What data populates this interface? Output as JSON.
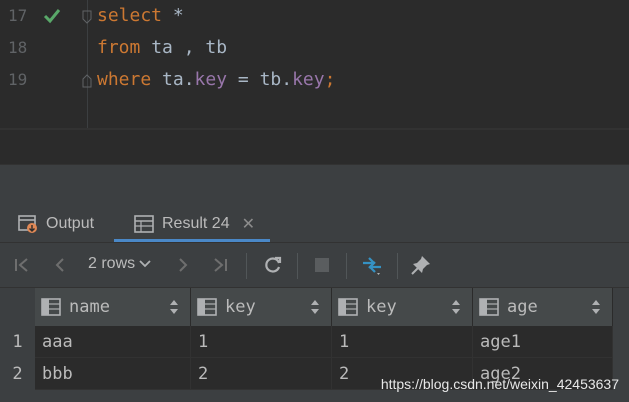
{
  "editor": {
    "lines": [
      {
        "num": "17",
        "kw1": "select",
        "rest": " *"
      },
      {
        "num": "18",
        "kw1": "from",
        "rest": " ta , tb"
      },
      {
        "num": "19",
        "kw1": "where",
        "a": " ta.",
        "f1": "key",
        "b": " = tb.",
        "f2": "key",
        "end": ";"
      }
    ]
  },
  "tabs": [
    {
      "label": "Output",
      "icon": "output-icon"
    },
    {
      "label": "Result 24",
      "icon": "table-icon",
      "close": "✕"
    }
  ],
  "toolbar": {
    "rows_label": "2 rows",
    "buttons": [
      "first-page-icon",
      "prev-page-icon",
      "next-page-icon",
      "last-page-icon",
      "refresh-icon",
      "stop-icon",
      "compare-icon",
      "pin-icon"
    ]
  },
  "grid": {
    "columns": [
      "name",
      "key",
      "key",
      "age"
    ],
    "rows": [
      {
        "num": "1",
        "cells": [
          "aaa",
          "1",
          "1",
          "age1"
        ]
      },
      {
        "num": "2",
        "cells": [
          "bbb",
          "2",
          "2",
          "age2"
        ]
      }
    ]
  },
  "watermark": "https://blog.csdn.net/weixin_42453637",
  "colors": {
    "keyword": "#cc7832",
    "field": "#9876aa",
    "accent": "#4a88c7",
    "success": "#59a869"
  }
}
